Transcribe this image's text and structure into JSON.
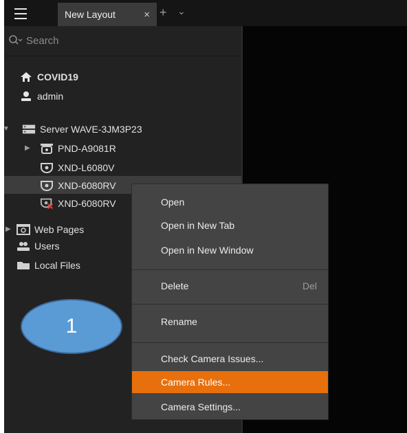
{
  "tabbar": {
    "tab_label": "New Layout",
    "close_glyph": "×",
    "add_glyph": "+",
    "menu_glyph": "⌄"
  },
  "search": {
    "placeholder": "Search"
  },
  "tree": {
    "system": "COVID19",
    "user": "admin",
    "server": "Server WAVE-3JM3P23",
    "cameras": [
      "PND-A9081R",
      "XND-L6080V",
      "XND-6080RV",
      "XND-6080RV"
    ],
    "web_pages": "Web Pages",
    "users": "Users",
    "local_files": "Local Files"
  },
  "context_menu": {
    "open": "Open",
    "open_new_tab": "Open in New Tab",
    "open_new_window": "Open in New Window",
    "delete": "Delete",
    "delete_shortcut": "Del",
    "rename": "Rename",
    "check_issues": "Check Camera Issues...",
    "camera_rules": "Camera Rules...",
    "camera_settings": "Camera Settings..."
  },
  "annotation": {
    "label": "1"
  },
  "colors": {
    "highlight": "#e8700c",
    "panel": "#222222",
    "callout": "#5b9bd5"
  }
}
